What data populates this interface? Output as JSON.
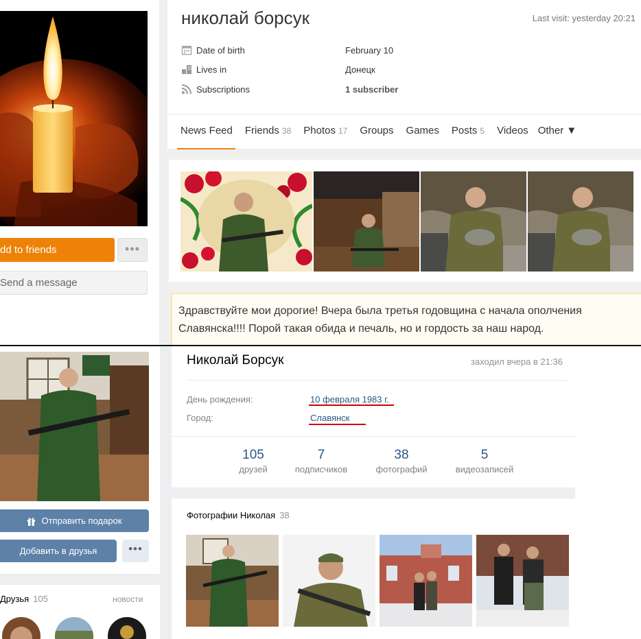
{
  "ok_profile": {
    "name": "николай борсук",
    "last_visit": "Last visit: yesterday 20:21",
    "info": [
      {
        "icon": "calendar-icon",
        "label": "Date of birth",
        "value": "February 10"
      },
      {
        "icon": "house-icon",
        "label": "Lives in",
        "value": "Донецк"
      },
      {
        "icon": "rss-icon",
        "label": "Subscriptions",
        "value": "1 subscriber"
      }
    ],
    "tabs": [
      {
        "label": "News Feed",
        "count": ""
      },
      {
        "label": "Friends",
        "count": "38"
      },
      {
        "label": "Photos",
        "count": "17"
      },
      {
        "label": "Groups",
        "count": ""
      },
      {
        "label": "Games",
        "count": ""
      },
      {
        "label": "Posts",
        "count": "5"
      },
      {
        "label": "Videos",
        "count": ""
      },
      {
        "label": "Other ▼",
        "count": ""
      }
    ],
    "add_friend_label": "dd to friends",
    "send_message_label": "Send a message",
    "more_label": "•••",
    "post_text": "Здравствуйте мои дорогие! Вчера была третья годовщина с начала ополчения Славянска!!!! Порой такая обида и печаль, но и гордость за наш народ.",
    "accent_color": "#ee8208"
  },
  "vk_profile": {
    "name": "Николай Борсук",
    "online_status": "заходил вчера в 21:36",
    "birthday_label": "День рождения:",
    "birthday_value": "10 февраля 1983 г.",
    "city_label": "Город:",
    "city_value": "Славянск",
    "stats": [
      {
        "number": "105",
        "label": "друзей"
      },
      {
        "number": "7",
        "label": "подписчиков"
      },
      {
        "number": "38",
        "label": "фотографий"
      },
      {
        "number": "5",
        "label": "видеозаписей"
      }
    ],
    "gift_button_label": "Отправить подарок",
    "add_friend_label": "Добавить в друзья",
    "more_label": "•••",
    "friends_title": "Друзья",
    "friends_count": "105",
    "friends_news_label": "новости",
    "photos_title": "Фотографии Николая",
    "photos_count": "38",
    "accent_color": "#5e81a8"
  }
}
